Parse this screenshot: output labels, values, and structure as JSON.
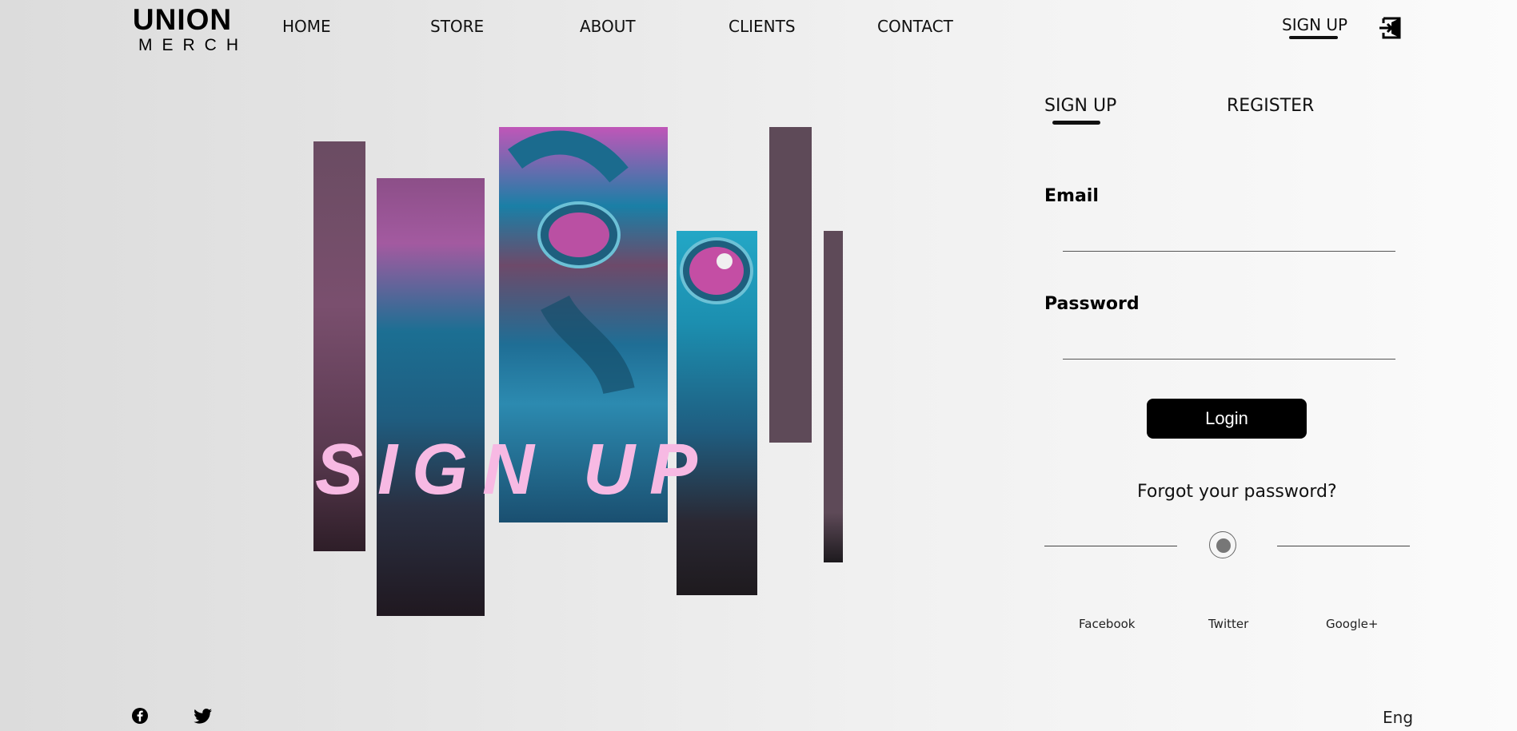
{
  "brand": {
    "top": "UNION",
    "bottom": "MERCH"
  },
  "nav": {
    "home": "HOME",
    "store": "STORE",
    "about": "ABOUT",
    "clients": "CLIENTS",
    "contact": "CONTACT"
  },
  "header": {
    "signup": "SIGN UP",
    "login_icon": "login-icon"
  },
  "hero": {
    "text": "SIGN UP"
  },
  "tabs": {
    "signup": "SIGN UP",
    "register": "REGISTER",
    "active": "signup"
  },
  "form": {
    "email_label": "Email",
    "email_value": "",
    "password_label": "Password",
    "password_value": "",
    "login_button": "Login",
    "forgot": "Forgot your password?"
  },
  "social": {
    "facebook": "Facebook",
    "twitter": "Twitter",
    "google": "Google+"
  },
  "footer": {
    "facebook_icon": "facebook-icon",
    "twitter_icon": "twitter-icon",
    "language": "Eng"
  },
  "colors": {
    "accent_text": "#f7b9e3",
    "strip": "#5e4a58",
    "button": "#000000"
  }
}
